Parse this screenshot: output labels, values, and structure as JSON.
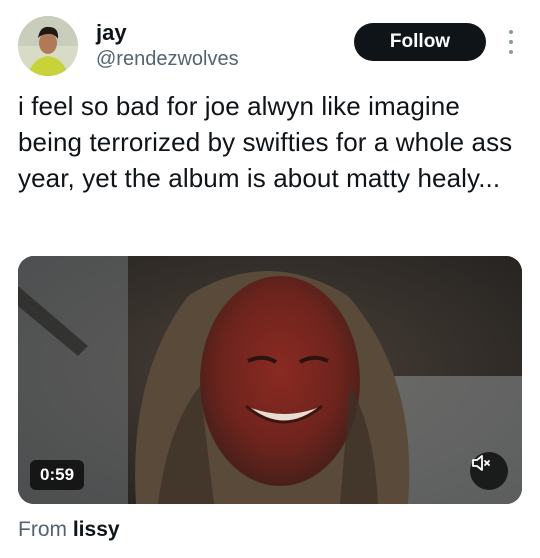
{
  "author": {
    "name": "jay",
    "handle": "@rendezwolves"
  },
  "follow_label": "Follow",
  "tweet": {
    "text": "i feel so bad for joe alwyn like imagine being terrorized by swifties for a whole ass year, yet the album is about matty healy..."
  },
  "media": {
    "duration": "0:59",
    "muted": true
  },
  "attribution": {
    "prefix": "From",
    "source": "lissy"
  },
  "colors": {
    "follow_bg": "#0f1419",
    "secondary_text": "#536471"
  }
}
